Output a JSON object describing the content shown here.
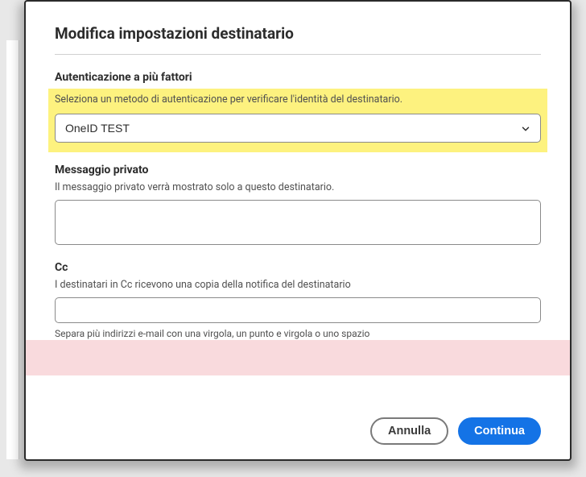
{
  "dialog": {
    "title": "Modifica impostazioni destinatario"
  },
  "mfa": {
    "label": "Autenticazione a più fattori",
    "sub": "Seleziona un metodo di autenticazione per verificare l'identità del destinatario.",
    "selected": "OneID TEST"
  },
  "privateMessage": {
    "label": "Messaggio privato",
    "sub": "Il messaggio privato verrà mostrato solo a questo destinatario.",
    "value": ""
  },
  "cc": {
    "label": "Cc",
    "sub": "I destinatari in Cc ricevono una copia della notifica del destinatario",
    "value": "",
    "hint": "Separa più indirizzi e-mail con una virgola, un punto e virgola o uno spazio"
  },
  "footer": {
    "cancel": "Annulla",
    "continue": "Continua"
  }
}
